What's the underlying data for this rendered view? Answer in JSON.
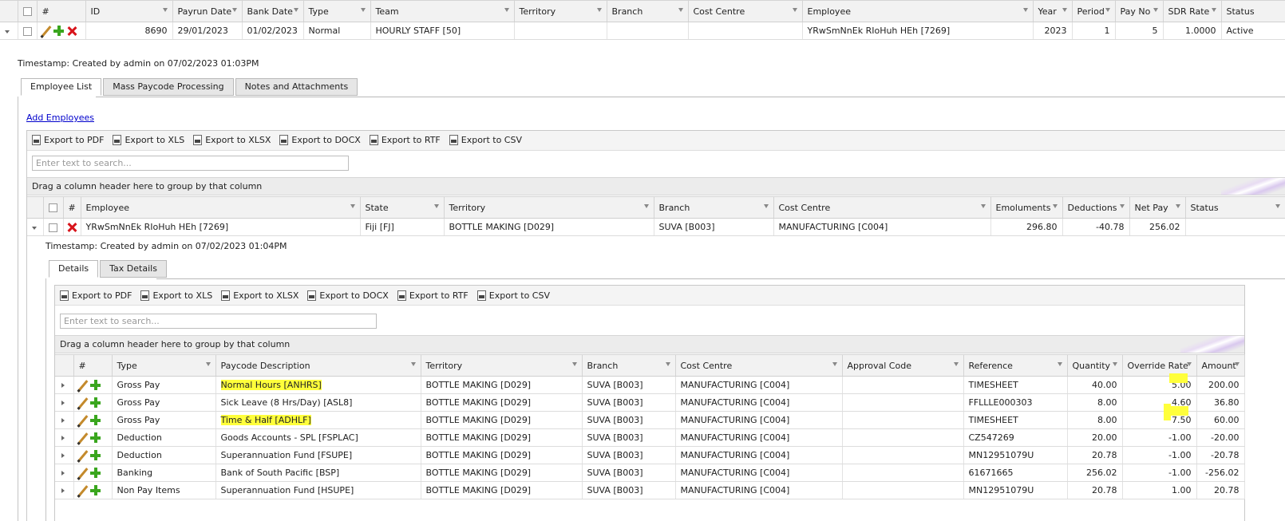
{
  "top_grid": {
    "headers": [
      "#",
      "ID",
      "Payrun Date",
      "Bank Date",
      "Type",
      "Team",
      "Territory",
      "Branch",
      "Cost Centre",
      "Employee",
      "Year",
      "Period",
      "Pay No",
      "SDR Rate",
      "Status"
    ],
    "row": {
      "id": "8690",
      "payrun_date": "29/01/2023",
      "bank_date": "01/02/2023",
      "type": "Normal",
      "team": "HOURLY STAFF [50]",
      "territory": "",
      "branch": "",
      "cost_centre": "",
      "employee": "YRwSmNnEk RIoHuh HEh [7269]",
      "year": "2023",
      "period": "1",
      "pay_no": "5",
      "sdr_rate": "1.0000",
      "status": "Active"
    }
  },
  "timestamp1": "Timestamp: Created by admin on 07/02/2023 01:03PM",
  "tabs1": [
    "Employee List",
    "Mass Paycode Processing",
    "Notes and Attachments"
  ],
  "add_employees": "Add Employees",
  "export": [
    "Export to PDF",
    "Export to XLS",
    "Export to XLSX",
    "Export to DOCX",
    "Export to RTF",
    "Export to CSV"
  ],
  "search_placeholder": "Enter text to search...",
  "group_hint": "Drag a column header here to group by that column",
  "emp_grid": {
    "headers": [
      "#",
      "Employee",
      "State",
      "Territory",
      "Branch",
      "Cost Centre",
      "Emoluments",
      "Deductions",
      "Net Pay",
      "Status"
    ],
    "row": {
      "employee": "YRwSmNnEk RIoHuh HEh [7269]",
      "state": "Fiji [FJ]",
      "territory": "BOTTLE MAKING [D029]",
      "branch": "SUVA [B003]",
      "cost_centre": "MANUFACTURING [C004]",
      "emoluments": "296.80",
      "deductions": "-40.78",
      "net_pay": "256.02",
      "status": ""
    }
  },
  "timestamp2": "Timestamp: Created by admin on 07/02/2023 01:04PM",
  "tabs2": [
    "Details",
    "Tax Details"
  ],
  "detail_grid": {
    "headers": [
      "#",
      "Type",
      "Paycode Description",
      "Territory",
      "Branch",
      "Cost Centre",
      "Approval Code",
      "Reference",
      "Quantity",
      "Override Rate",
      "Amount"
    ],
    "rows": [
      {
        "type": "Gross Pay",
        "desc": "Normal Hours [ANHRS]",
        "territory": "BOTTLE MAKING [D029]",
        "branch": "SUVA [B003]",
        "cost_centre": "MANUFACTURING [C004]",
        "approval": "",
        "reference": "TIMESHEET",
        "quantity": "40.00",
        "rate": "5.00",
        "amount": "200.00"
      },
      {
        "type": "Gross Pay",
        "desc": "Sick Leave (8 Hrs/Day) [ASL8]",
        "territory": "BOTTLE MAKING [D029]",
        "branch": "SUVA [B003]",
        "cost_centre": "MANUFACTURING [C004]",
        "approval": "",
        "reference": "FFLLLE000303",
        "quantity": "8.00",
        "rate": "4.60",
        "amount": "36.80"
      },
      {
        "type": "Gross Pay",
        "desc": "Time & Half [ADHLF]",
        "territory": "BOTTLE MAKING [D029]",
        "branch": "SUVA [B003]",
        "cost_centre": "MANUFACTURING [C004]",
        "approval": "",
        "reference": "TIMESHEET",
        "quantity": "8.00",
        "rate": "7.50",
        "amount": "60.00"
      },
      {
        "type": "Deduction",
        "desc": "Goods Accounts - SPL [FSPLAC]",
        "territory": "BOTTLE MAKING [D029]",
        "branch": "SUVA [B003]",
        "cost_centre": "MANUFACTURING [C004]",
        "approval": "",
        "reference": "CZ547269",
        "quantity": "20.00",
        "rate": "-1.00",
        "amount": "-20.00"
      },
      {
        "type": "Deduction",
        "desc": "Superannuation Fund [FSUPE]",
        "territory": "BOTTLE MAKING [D029]",
        "branch": "SUVA [B003]",
        "cost_centre": "MANUFACTURING [C004]",
        "approval": "",
        "reference": "MN12951079U",
        "quantity": "20.78",
        "rate": "-1.00",
        "amount": "-20.78"
      },
      {
        "type": "Banking",
        "desc": "Bank of South Pacific [BSP]",
        "territory": "BOTTLE MAKING [D029]",
        "branch": "SUVA [B003]",
        "cost_centre": "MANUFACTURING [C004]",
        "approval": "",
        "reference": "61671665",
        "quantity": "256.02",
        "rate": "-1.00",
        "amount": "-256.02"
      },
      {
        "type": "Non Pay Items",
        "desc": "Superannuation Fund [HSUPE]",
        "territory": "BOTTLE MAKING [D029]",
        "branch": "SUVA [B003]",
        "cost_centre": "MANUFACTURING [C004]",
        "approval": "",
        "reference": "MN12951079U",
        "quantity": "20.78",
        "rate": "1.00",
        "amount": "20.78"
      }
    ]
  },
  "colors": {
    "highlight": "#ffff3b",
    "link": "#0000cc",
    "delete": "#d8141b",
    "add": "#3aa61e"
  }
}
